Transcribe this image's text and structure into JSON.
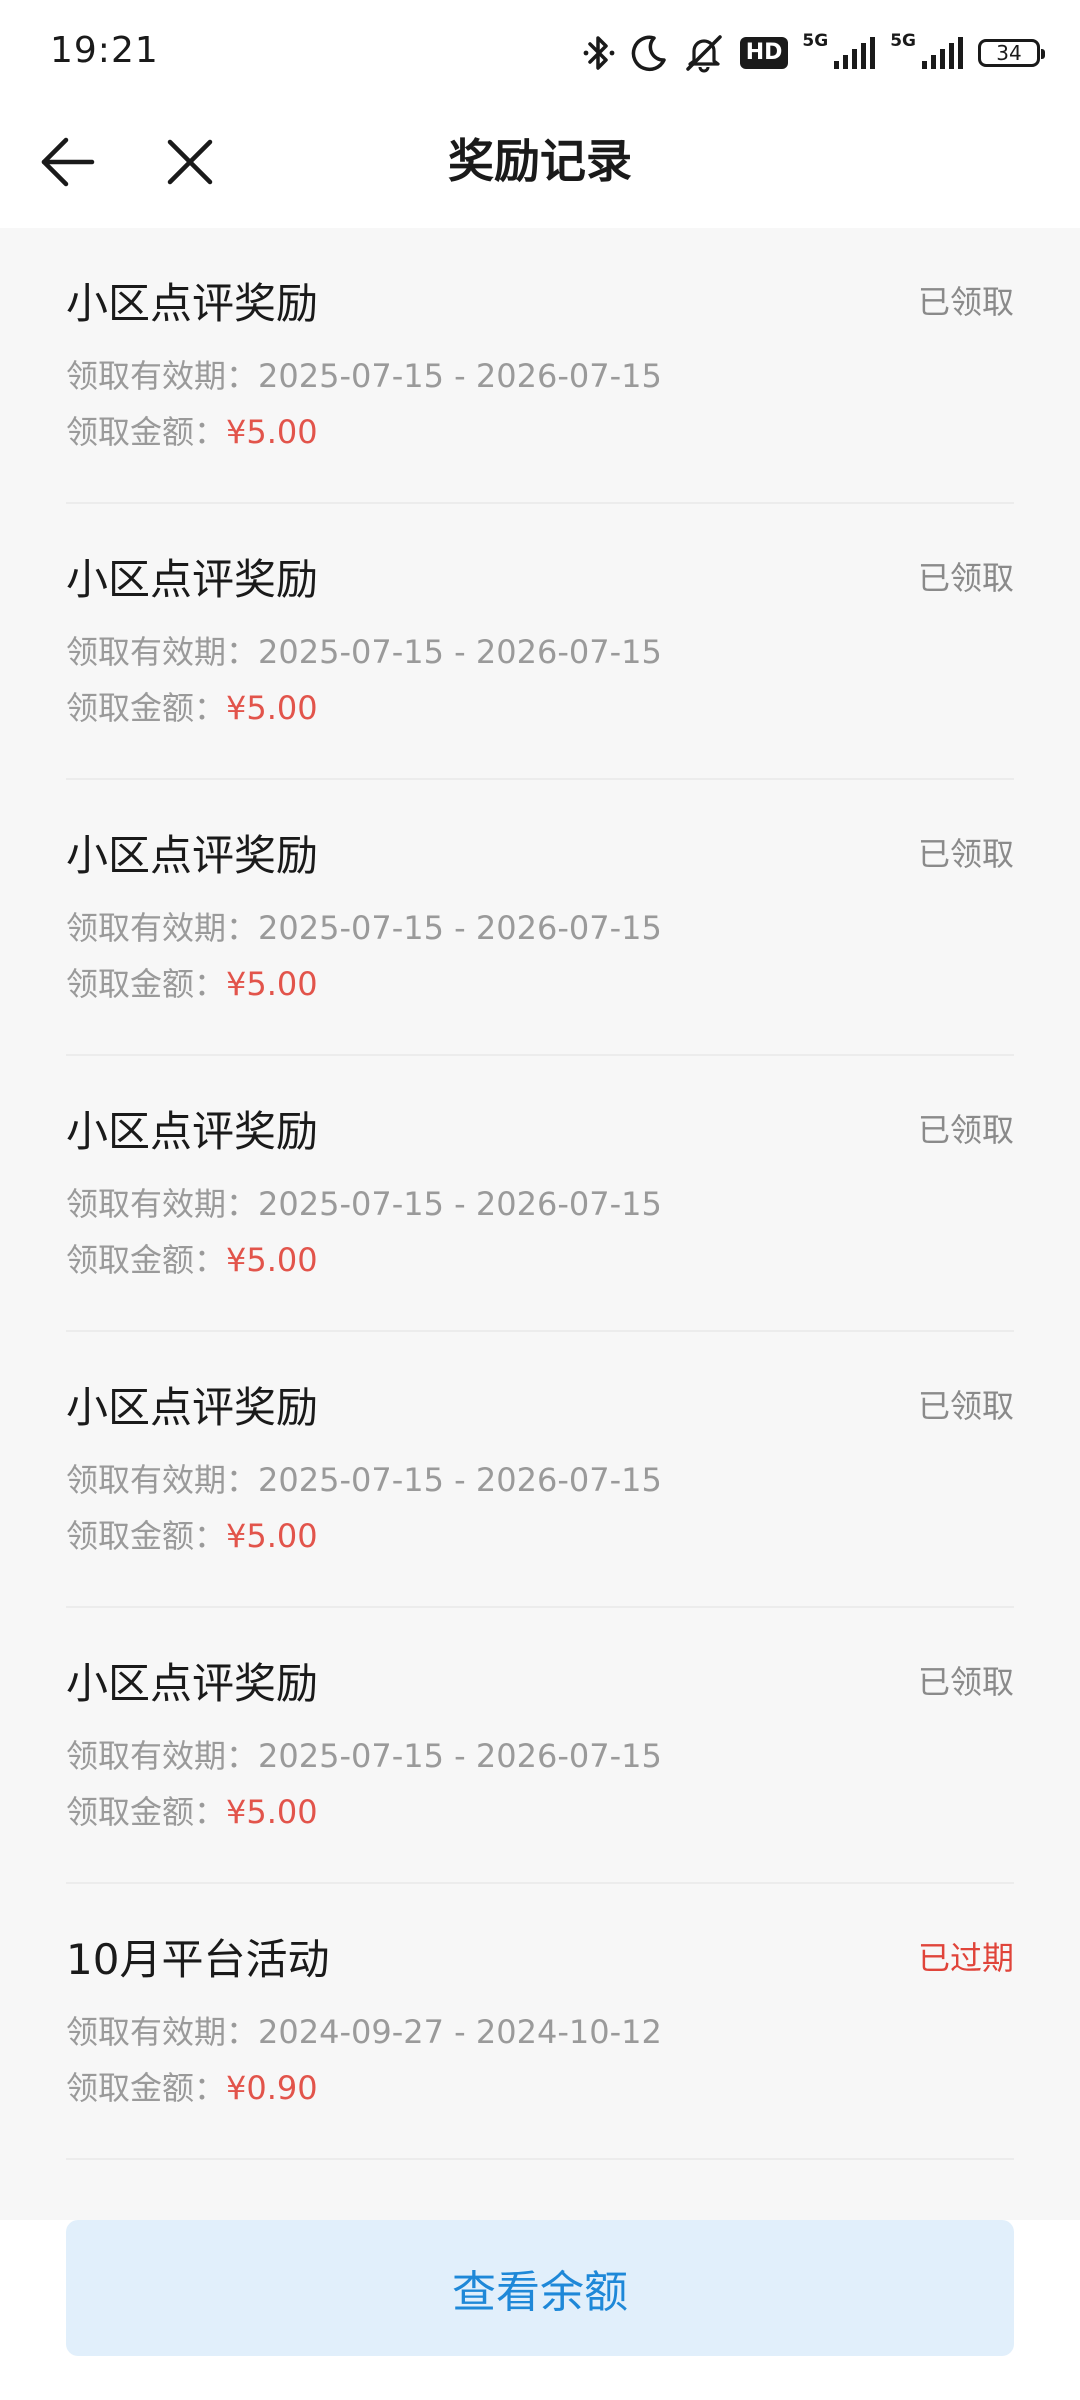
{
  "status_bar": {
    "time": "19:21",
    "network_1": "5G",
    "network_2": "5G",
    "hd_label": "HD",
    "battery": "34",
    "icons": [
      "bluetooth-icon",
      "moon-icon",
      "mute-icon",
      "hd-icon",
      "signal-icon",
      "signal-icon",
      "battery-icon"
    ]
  },
  "header": {
    "title": "奖励记录",
    "back_icon": "arrow-left-icon",
    "close_icon": "close-icon"
  },
  "records": [
    {
      "title": "小区点评奖励",
      "status": "已领取",
      "validity_label": "领取有效期：",
      "validity": "2025-07-15 - 2026-07-15",
      "amount_label": "领取金额：",
      "amount": "¥5.00"
    },
    {
      "title": "小区点评奖励",
      "status": "已领取",
      "validity_label": "领取有效期：",
      "validity": "2025-07-15 - 2026-07-15",
      "amount_label": "领取金额：",
      "amount": "¥5.00"
    },
    {
      "title": "小区点评奖励",
      "status": "已领取",
      "validity_label": "领取有效期：",
      "validity": "2025-07-15 - 2026-07-15",
      "amount_label": "领取金额：",
      "amount": "¥5.00"
    },
    {
      "title": "小区点评奖励",
      "status": "已领取",
      "validity_label": "领取有效期：",
      "validity": "2025-07-15 - 2026-07-15",
      "amount_label": "领取金额：",
      "amount": "¥5.00"
    },
    {
      "title": "小区点评奖励",
      "status": "已领取",
      "validity_label": "领取有效期：",
      "validity": "2025-07-15 - 2026-07-15",
      "amount_label": "领取金额：",
      "amount": "¥5.00"
    },
    {
      "title": "小区点评奖励",
      "status": "已领取",
      "validity_label": "领取有效期：",
      "validity": "2025-07-15 - 2026-07-15",
      "amount_label": "领取金额：",
      "amount": "¥5.00"
    },
    {
      "title": "10月平台活动",
      "status": "已过期",
      "validity_label": "领取有效期：",
      "validity": "2024-09-27 - 2024-10-12",
      "amount_label": "领取金额：",
      "amount": "¥0.90"
    }
  ],
  "footer": {
    "balance_button_label": "查看余额"
  },
  "colors": {
    "amount": "#e2544b",
    "expired": "#e0443a",
    "claimed": "#8a8a8a",
    "button_bg": "#e1effb",
    "button_text": "#1e88d8",
    "page_bg": "#f7f7f7"
  }
}
